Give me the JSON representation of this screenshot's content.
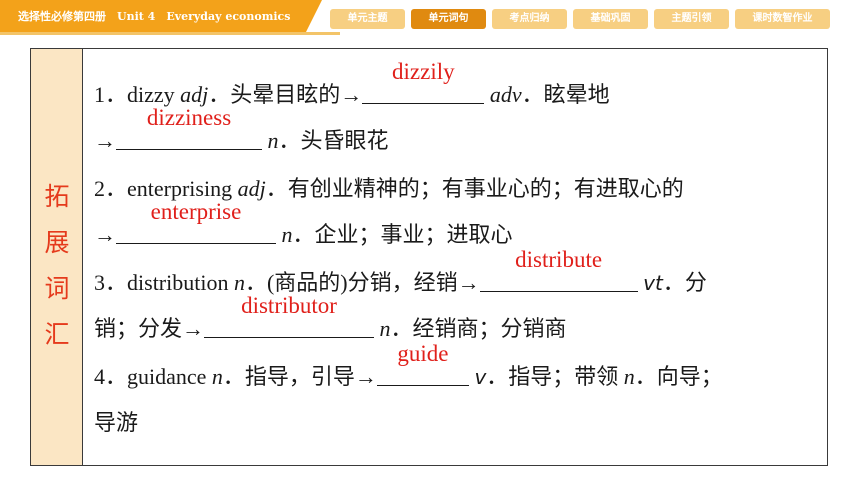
{
  "header": {
    "title": "选择性必修第四册　Unit 4　Everyday economics",
    "nav": [
      "单元主题",
      "单元词句",
      "考点归纳",
      "基础巩固",
      "主题引领",
      "课时数智作业"
    ],
    "active_index": 1
  },
  "section_label": [
    "拓",
    "展",
    "词",
    "汇"
  ],
  "entries": {
    "e1": {
      "num": "1．",
      "word": "dizzy",
      "pos": "adj",
      "mid": "．头晕目眩的→",
      "ans1": "dizzily",
      "pos2": "adv",
      "mid2": "．眩晕地",
      "arrow": "→",
      "ans2": "dizziness",
      "pos3": "n",
      "mid3": "．头昏眼花"
    },
    "e2": {
      "num": "2．",
      "word": "enterprising",
      "pos": "adj",
      "mid": "．有创业精神的；有事业心的；有进取心的",
      "arrow": "→",
      "ans1": "enterprise",
      "pos2": "n",
      "mid2": "．企业；事业；进取心"
    },
    "e3": {
      "num": "3．",
      "word": "distribution",
      "pos": "n",
      "mid": "．(商品的)分销，经销→",
      "ans1": "distribute",
      "pos2": "vt",
      "mid2": "．分",
      "cont": "销；分发→",
      "ans2": "distributor",
      "pos3": "n",
      "mid3": "．经销商；分销商"
    },
    "e4": {
      "num": "4．",
      "word": "guidance",
      "pos": "n",
      "mid": "．指导，引导→",
      "ans1": "guide",
      "pos2": "v",
      "mid2": "．指导；带领",
      "pos3": "n",
      "mid3": "．向导；",
      "cont": "导游"
    }
  },
  "colors": {
    "accent": "#f3a21a",
    "answer": "#e0201b",
    "label_bg": "#fbe6c4",
    "label_text": "#e53a1c"
  }
}
